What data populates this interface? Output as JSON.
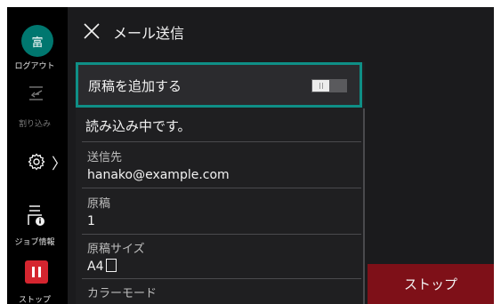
{
  "rail": {
    "avatar_char": "富",
    "logout_label": "ログアウト",
    "interrupt_label": "割り込み",
    "settings_chevron": "〉",
    "job_info_label": "ジョブ情報",
    "stop_label": "ストップ"
  },
  "header": {
    "title": "メール送信",
    "close_icon": "close-icon"
  },
  "panel": {
    "add_original_label": "原稿を追加する",
    "add_original_toggle": "off",
    "status_text": "読み込み中です。",
    "fields": [
      {
        "caption": "送信先",
        "value": "hanako@example.com"
      },
      {
        "caption": "原稿",
        "value": "1"
      },
      {
        "caption": "原稿サイズ",
        "value": "A4"
      },
      {
        "caption": "カラーモード",
        "value": ""
      }
    ]
  },
  "actions": {
    "stop_button": "ストップ"
  },
  "colors": {
    "accent_teal": "#0f8f86",
    "avatar_teal": "#00776f",
    "stop_red": "#7e1018",
    "rail_stop_red": "#d5252f"
  }
}
